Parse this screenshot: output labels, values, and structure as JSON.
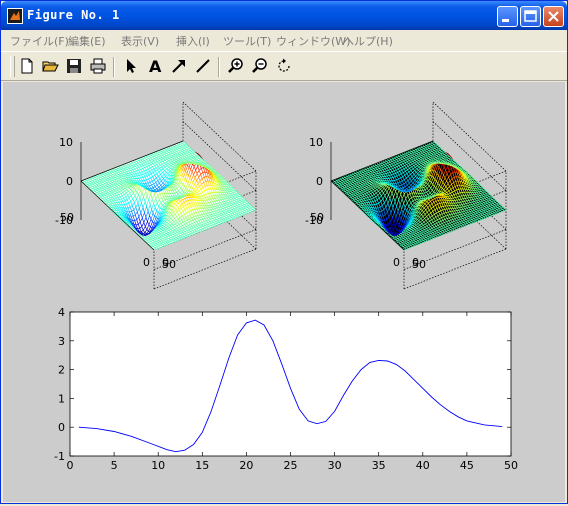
{
  "window": {
    "title": "Figure No. 1",
    "buttons": [
      "minimize",
      "maximize",
      "close"
    ]
  },
  "menu": [
    {
      "label": "ファイル(F)"
    },
    {
      "label": "編集(E)"
    },
    {
      "label": "表示(V)"
    },
    {
      "label": "挿入(I)"
    },
    {
      "label": "ツール(T)"
    },
    {
      "label": "ウィンドウ(W)"
    },
    {
      "label": "ヘルプ(H)"
    }
  ],
  "toolbar": {
    "tools": [
      "new-file-icon",
      "open-folder-icon",
      "save-icon",
      "print-icon",
      "select-arrow-icon",
      "text-icon",
      "arrow-icon",
      "line-icon",
      "zoom-in-icon",
      "zoom-out-icon",
      "rotate-icon"
    ],
    "text_tool_glyph": "A"
  },
  "chart_data": [
    {
      "type": "surface-mesh",
      "colormap": "jet",
      "zlim": [
        -10,
        10
      ],
      "z_ticks": [
        "10",
        "0",
        "-10"
      ],
      "x_ticks": [
        "0",
        "50"
      ],
      "y_ticks": [
        "50",
        "0"
      ],
      "grid": true
    },
    {
      "type": "surface-mesh",
      "colormap": "jet with black mesh",
      "zlim": [
        -10,
        10
      ],
      "z_ticks": [
        "10",
        "0",
        "-10"
      ],
      "x_ticks": [
        "0",
        "50"
      ],
      "y_ticks": [
        "50",
        "0"
      ],
      "grid": true
    },
    {
      "type": "line",
      "x_ticks": [
        "0",
        "5",
        "10",
        "15",
        "20",
        "25",
        "30",
        "35",
        "40",
        "45",
        "50"
      ],
      "y_ticks": [
        "-1",
        "0",
        "1",
        "2",
        "3",
        "4"
      ],
      "xlim": [
        0,
        50
      ],
      "ylim": [
        -1,
        4
      ],
      "color": "#0000ff",
      "series": [
        {
          "x": [
            1,
            3,
            5,
            7,
            9,
            11,
            12,
            13,
            14,
            15,
            16,
            17,
            18,
            19,
            20,
            21,
            22,
            23,
            24,
            25,
            26,
            27,
            28,
            29,
            30,
            31,
            32,
            33,
            34,
            35,
            36,
            37,
            38,
            39,
            40,
            41,
            42,
            43,
            44,
            45,
            47,
            49
          ],
          "y": [
            0.0,
            -0.05,
            -0.15,
            -0.32,
            -0.55,
            -0.78,
            -0.85,
            -0.8,
            -0.6,
            -0.18,
            0.55,
            1.45,
            2.4,
            3.2,
            3.62,
            3.72,
            3.55,
            3.0,
            2.2,
            1.35,
            0.62,
            0.22,
            0.12,
            0.2,
            0.55,
            1.1,
            1.6,
            2.0,
            2.25,
            2.32,
            2.3,
            2.18,
            1.95,
            1.65,
            1.35,
            1.05,
            0.78,
            0.55,
            0.36,
            0.22,
            0.08,
            0.02
          ]
        }
      ]
    }
  ]
}
